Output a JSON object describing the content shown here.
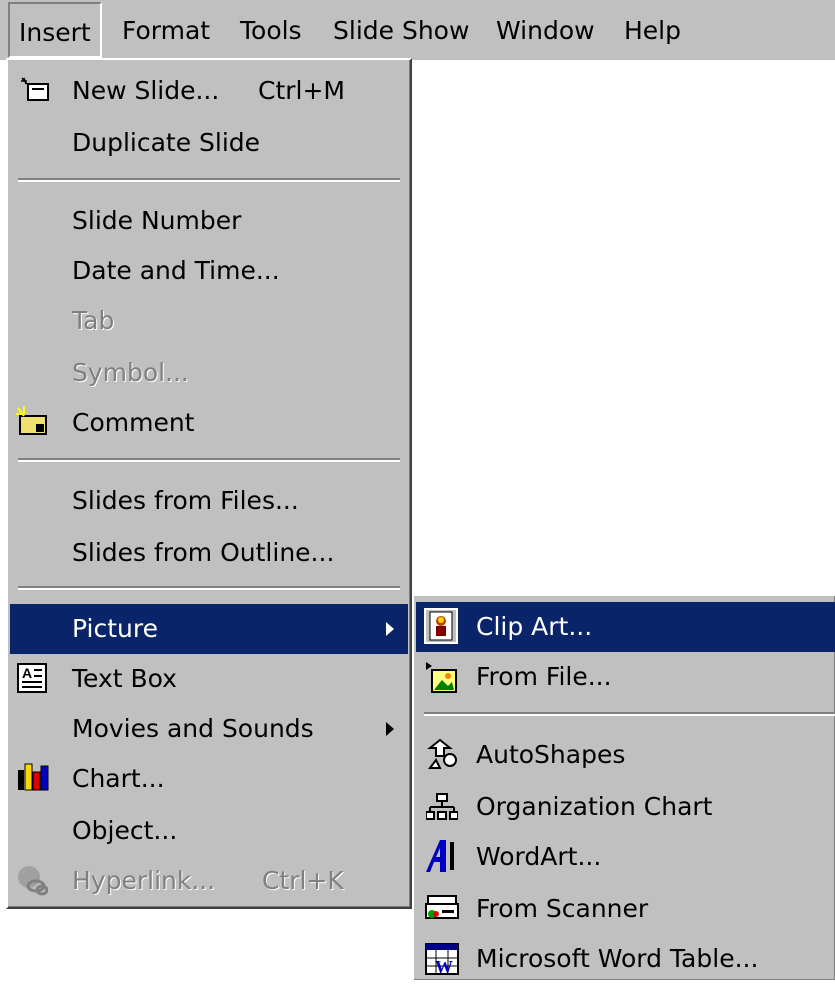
{
  "menubar": {
    "items": [
      "Insert",
      "Format",
      "Tools",
      "Slide Show",
      "Window",
      "Help"
    ]
  },
  "insert_menu": {
    "new_slide": "New Slide...",
    "new_slide_shortcut": "Ctrl+M",
    "duplicate_slide": "Duplicate Slide",
    "slide_number": "Slide Number",
    "date_time": "Date and Time...",
    "tab": "Tab",
    "symbol": "Symbol...",
    "comment": "Comment",
    "slides_from_files": "Slides from Files...",
    "slides_from_outline": "Slides from Outline...",
    "picture": "Picture",
    "text_box": "Text Box",
    "movies_sounds": "Movies and Sounds",
    "chart": "Chart...",
    "object": "Object...",
    "hyperlink": "Hyperlink...",
    "hyperlink_shortcut": "Ctrl+K"
  },
  "picture_submenu": {
    "clip_art": "Clip Art...",
    "from_file": "From File...",
    "autoshapes": "AutoShapes",
    "org_chart": "Organization Chart",
    "wordart": "WordArt...",
    "from_scanner": "From Scanner",
    "word_table": "Microsoft Word Table..."
  },
  "colors": {
    "menu_bg": "#c0c0c0",
    "highlight": "#0a246a",
    "disabled": "#808080"
  }
}
